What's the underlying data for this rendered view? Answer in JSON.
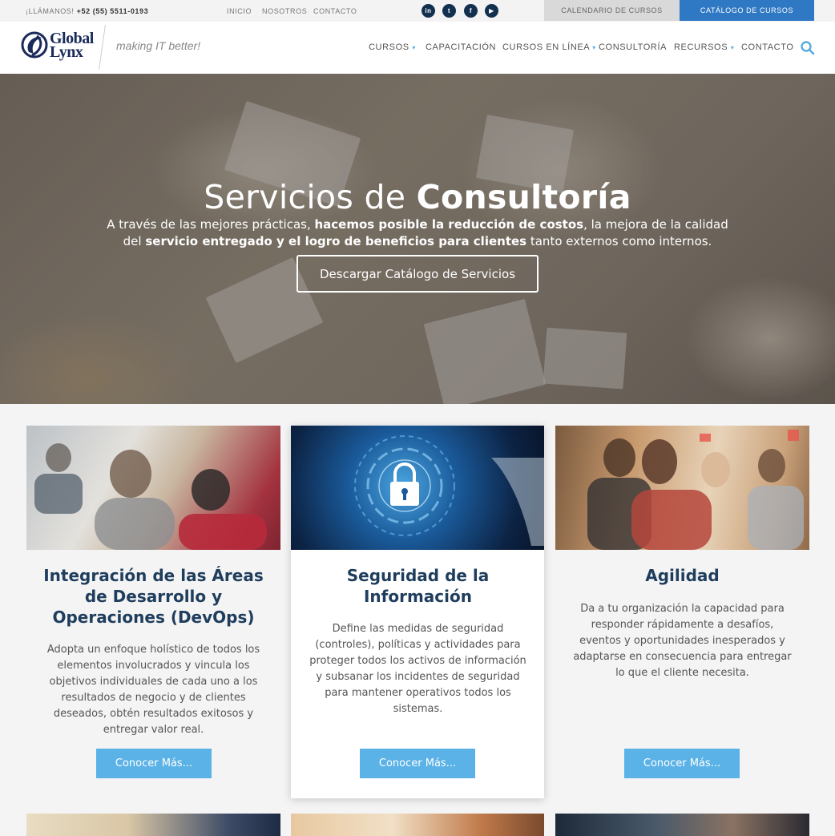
{
  "topbar": {
    "call_label": "¡LLÁMANOS!",
    "phone": "+52 (55) 5511-0193",
    "nav": [
      "INICIO",
      "NOSOTROS",
      "CONTACTO"
    ],
    "social": [
      {
        "icon": "linkedin-icon",
        "glyph": "in"
      },
      {
        "icon": "twitter-icon",
        "glyph": "t"
      },
      {
        "icon": "facebook-icon",
        "glyph": "f"
      },
      {
        "icon": "youtube-icon",
        "glyph": "▶"
      }
    ],
    "calendar_label": "CALENDARIO DE CURSOS",
    "catalog_label": "CATÁLOGO DE CURSOS"
  },
  "header": {
    "logo_line1": "Global",
    "logo_line2": "Lynx",
    "tagline": "making IT better!",
    "nav": [
      {
        "label": "CURSOS",
        "dropdown": true
      },
      {
        "label": "CAPACITACIÓN",
        "dropdown": false
      },
      {
        "label": "CURSOS EN LÍNEA",
        "dropdown": true
      },
      {
        "label": "CONSULTORÍA",
        "dropdown": false
      },
      {
        "label": "RECURSOS",
        "dropdown": true
      },
      {
        "label": "CONTACTO",
        "dropdown": false
      }
    ]
  },
  "hero": {
    "title_light": "Servicios de ",
    "title_bold": "Consultoría",
    "text_1": "A través de las mejores prácticas, ",
    "text_2": "hacemos posible la reducción de costos",
    "text_3": ", la mejora de la calidad del ",
    "text_4": "servicio entregado y el logro de beneficios para clientes",
    "text_5": " tanto externos como internos.",
    "button": "Descargar Catálogo de Servicios"
  },
  "cards": [
    {
      "title": "Integración de las Áreas de Desarrollo y Operaciones (DevOps)",
      "text": "Adopta un enfoque holístico de todos los elementos involucrados y vincula los objetivos individuales de cada uno a los resultados de negocio y de clientes deseados, obtén resultados exitosos y entregar valor real.",
      "button": "Conocer Más..."
    },
    {
      "title": "Seguridad de la Información",
      "text": "Define las medidas de seguridad (controles), políticas y actividades para proteger todos los activos de información y subsanar los incidentes de seguridad para mantener operativos todos los sistemas.",
      "button": "Conocer Más..."
    },
    {
      "title": "Agilidad",
      "text": "Da a tu organización la capacidad para responder rápidamente a desafíos, eventos y oportunidades inesperados y adaptarse en consecuencia para entregar lo que el cliente necesita.",
      "button": "Conocer Más..."
    }
  ],
  "colors": {
    "brand_navy": "#1f3d5c",
    "accent_blue": "#5bb2e6",
    "catalog_blue": "#2f78c4"
  }
}
